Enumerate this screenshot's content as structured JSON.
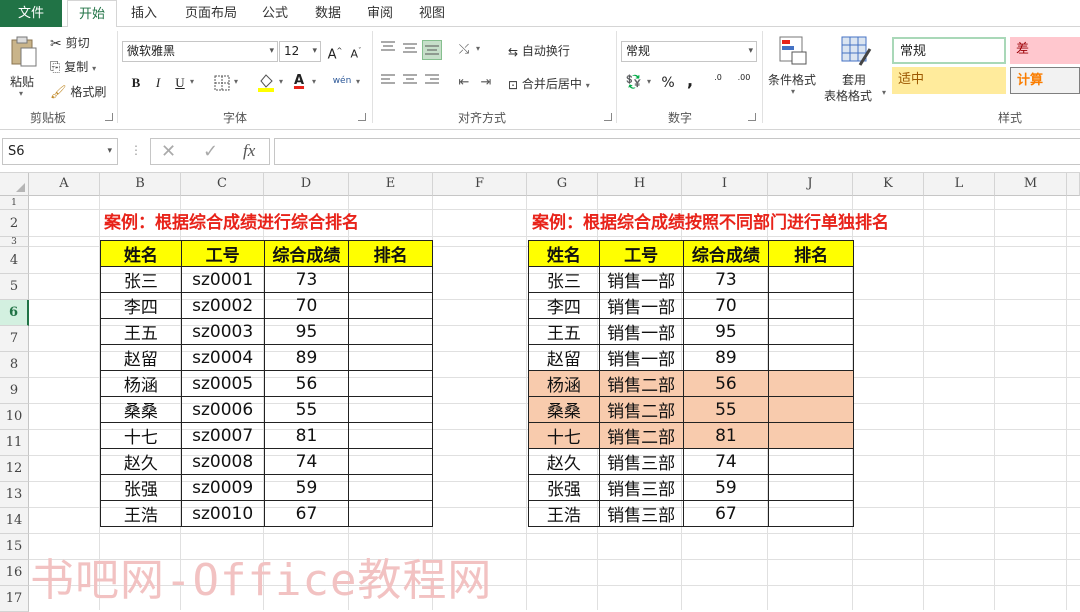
{
  "menu": {
    "tabs": [
      "文件",
      "开始",
      "插入",
      "页面布局",
      "公式",
      "数据",
      "审阅",
      "视图"
    ],
    "active": "开始"
  },
  "ribbon": {
    "clipboard": {
      "paste": "粘贴",
      "cut": "剪切",
      "copy": "复制",
      "format_painter": "格式刷",
      "label": "剪贴板"
    },
    "font": {
      "name": "微软雅黑",
      "size": "12",
      "bold": "B",
      "italic": "I",
      "underline": "U",
      "grow": "A",
      "shrink": "A",
      "label": "字体",
      "color_letter": "A",
      "phonetic": "wén"
    },
    "alignment": {
      "wrap": "自动换行",
      "merge": "合并后居中",
      "label": "对齐方式"
    },
    "number": {
      "format": "常规",
      "percent": "%",
      "comma": ",",
      "inc": ".0",
      "dec": ".00",
      "label": "数字"
    },
    "styles": {
      "conditional": "条件格式",
      "table_fmt_1": "套用",
      "table_fmt_2": "表格格式",
      "normal": "常规",
      "bad": "差",
      "neutral": "适中",
      "calc": "计算",
      "label": "样式"
    }
  },
  "formula_bar": {
    "name_box": "S6",
    "fx": "fx",
    "cancel": "✕",
    "enter": "✓",
    "formula": ""
  },
  "sheet": {
    "columns": [
      "A",
      "B",
      "C",
      "D",
      "E",
      "F",
      "G",
      "H",
      "I",
      "J",
      "K",
      "L",
      "M"
    ],
    "rows": [
      "1",
      "2",
      "3",
      "4",
      "5",
      "6",
      "7",
      "8",
      "9",
      "10",
      "11",
      "12",
      "13",
      "14",
      "15",
      "16",
      "17"
    ],
    "selected_row": "6",
    "title_left": "案例：根据综合成绩进行综合排名",
    "title_right": "案例：根据综合成绩按照不同部门进行单独排名",
    "left_table": {
      "headers": [
        "姓名",
        "工号",
        "综合成绩",
        "排名"
      ],
      "rows": [
        [
          "张三",
          "sz0001",
          "73",
          ""
        ],
        [
          "李四",
          "sz0002",
          "70",
          ""
        ],
        [
          "王五",
          "sz0003",
          "95",
          ""
        ],
        [
          "赵留",
          "sz0004",
          "89",
          ""
        ],
        [
          "杨涵",
          "sz0005",
          "56",
          ""
        ],
        [
          "桑桑",
          "sz0006",
          "55",
          ""
        ],
        [
          "十七",
          "sz0007",
          "81",
          ""
        ],
        [
          "赵久",
          "sz0008",
          "74",
          ""
        ],
        [
          "张强",
          "sz0009",
          "59",
          ""
        ],
        [
          "王浩",
          "sz0010",
          "67",
          ""
        ]
      ]
    },
    "right_table": {
      "headers": [
        "姓名",
        "工号",
        "综合成绩",
        "排名"
      ],
      "rows": [
        [
          "张三",
          "销售一部",
          "73",
          ""
        ],
        [
          "李四",
          "销售一部",
          "70",
          ""
        ],
        [
          "王五",
          "销售一部",
          "95",
          ""
        ],
        [
          "赵留",
          "销售一部",
          "89",
          ""
        ],
        [
          "杨涵",
          "销售二部",
          "56",
          ""
        ],
        [
          "桑桑",
          "销售二部",
          "55",
          ""
        ],
        [
          "十七",
          "销售二部",
          "81",
          ""
        ],
        [
          "赵久",
          "销售三部",
          "74",
          ""
        ],
        [
          "张强",
          "销售三部",
          "59",
          ""
        ],
        [
          "王浩",
          "销售三部",
          "67",
          ""
        ]
      ],
      "highlighted_rows": [
        4,
        5,
        6
      ],
      "highlight_color": "#f8cbad"
    },
    "watermark": "书吧网-Office教程网"
  },
  "colors": {
    "excel_green": "#217346",
    "title_red": "#e8231a",
    "header_yellow": "#ffff00"
  }
}
